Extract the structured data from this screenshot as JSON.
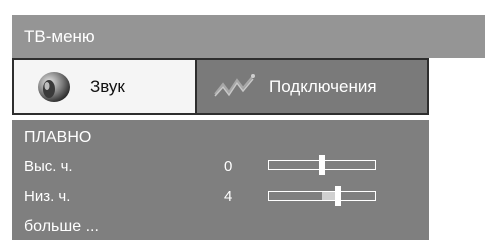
{
  "window": {
    "title": "ТВ-меню"
  },
  "tabs": [
    {
      "label": "Звук",
      "icon": "speaker-icon",
      "active": true
    },
    {
      "label": "Подключения",
      "icon": "connection-icon",
      "active": false
    }
  ],
  "menu": {
    "heading": "ПЛАВНО",
    "items": [
      {
        "label": "Выс. ч.",
        "value": "0",
        "level": 0.5
      },
      {
        "label": "Низ. ч.",
        "value": "4",
        "level": 0.65
      }
    ],
    "more": "больше ..."
  },
  "colors": {
    "title_bar": "#959595",
    "active_tab": "#f5f5f5",
    "inactive_tab": "#7a7a7a",
    "menu_background": "#7f7f7f"
  }
}
